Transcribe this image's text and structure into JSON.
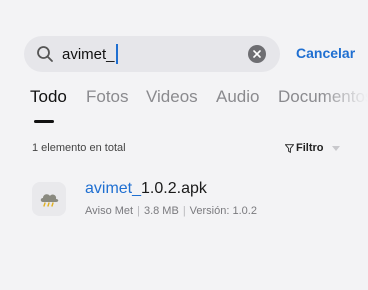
{
  "search": {
    "query": "avimet_"
  },
  "cancel_label": "Cancelar",
  "tabs": [
    {
      "label": "Todo"
    },
    {
      "label": "Fotos"
    },
    {
      "label": "Videos"
    },
    {
      "label": "Audio"
    },
    {
      "label": "Documentos"
    }
  ],
  "results": {
    "count_text": "1 elemento en total",
    "filter_label": "Filtro",
    "items": [
      {
        "name_highlight": "avimet_",
        "name_rest": "1.0.2.apk",
        "app_name": "Aviso Met",
        "size": "3.8 MB",
        "version": "Versión: 1.0.2",
        "icon": "cloud-icon"
      }
    ]
  },
  "colors": {
    "accent": "#1f6fd1",
    "background": "#f3f3f5",
    "search_bg": "#e6e6ea"
  }
}
